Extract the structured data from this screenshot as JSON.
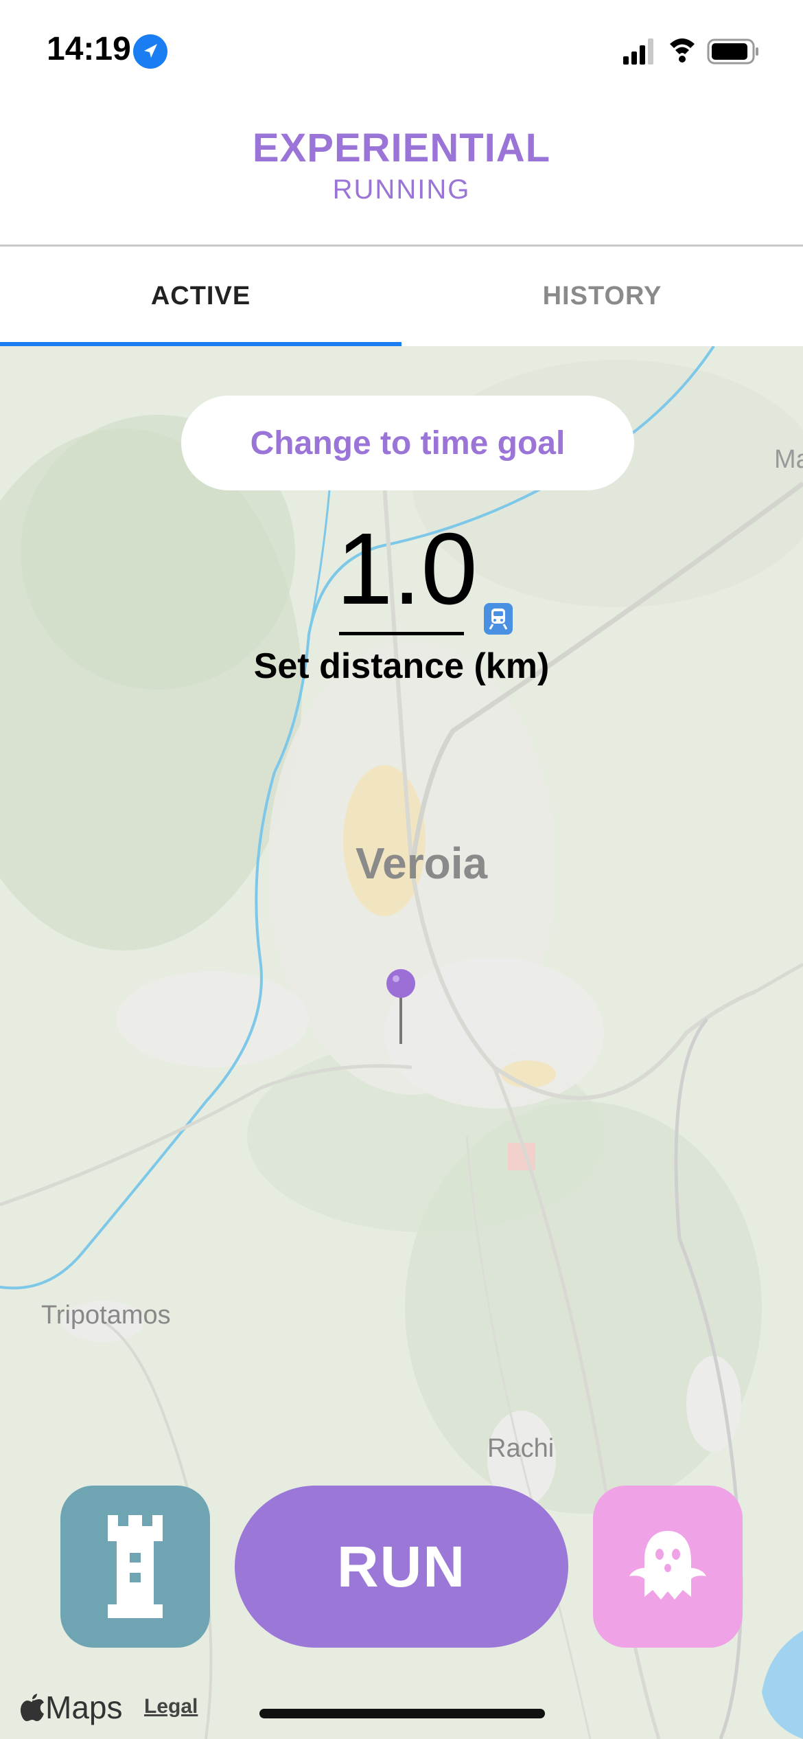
{
  "status_bar": {
    "time": "14:19",
    "icons": [
      "location-arrow-icon",
      "cellular-signal-icon",
      "wifi-icon",
      "battery-icon"
    ]
  },
  "header": {
    "title": "EXPERIENTIAL",
    "subtitle": "RUNNING"
  },
  "tabs": [
    {
      "label": "ACTIVE",
      "active": true
    },
    {
      "label": "HISTORY",
      "active": false
    }
  ],
  "goal": {
    "toggle_label": "Change to time goal",
    "value": "1.0",
    "label": "Set distance (km)"
  },
  "map": {
    "labels": {
      "city": "Veroia",
      "west_town": "Tripotamos",
      "south_town": "Rachi",
      "edge": "Ma"
    },
    "pin_color": "#9b6fd6"
  },
  "actions": {
    "run_label": "RUN",
    "left_icon": "tower-icon",
    "right_icon": "ghost-icon",
    "colors": {
      "tower": "#6fa5b3",
      "run": "#9b78d8",
      "ghost": "#f0a2e6"
    }
  },
  "footer": {
    "maps_label": "Maps",
    "legal_label": "Legal"
  },
  "colors": {
    "accent": "#9a74d6",
    "tab_indicator": "#1a7df2"
  }
}
